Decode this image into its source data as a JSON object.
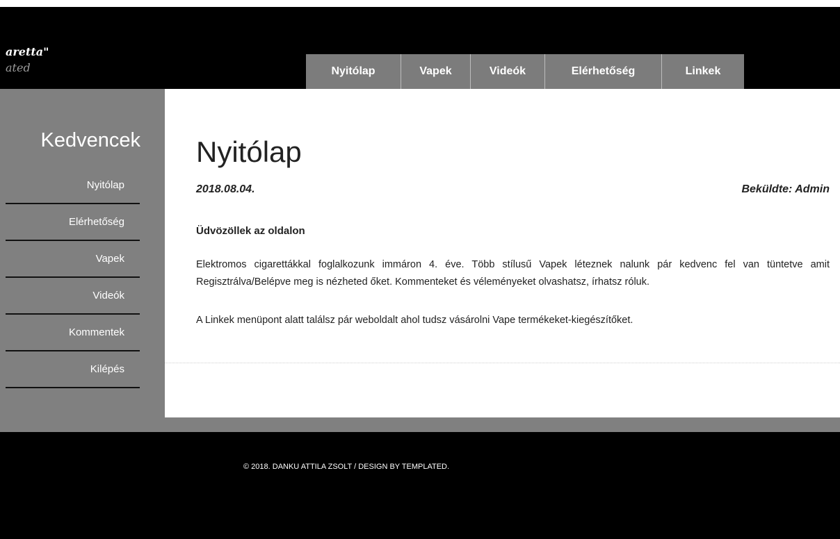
{
  "header": {
    "logo_line1": "aretta\"",
    "logo_line2": "ated"
  },
  "top_nav": [
    "Nyitólap",
    "Vapek",
    "Videók",
    "Elérhetőség",
    "Linkek"
  ],
  "sidebar": {
    "title": "Kedvencek",
    "items": [
      "Nyitólap",
      "Elérhetőség",
      "Vapek",
      "Videók",
      "Kommentek",
      "Kilépés"
    ]
  },
  "post": {
    "title": "Nyitólap",
    "date": "2018.08.04.",
    "author": "Beküldte: Admin",
    "welcome": "Üdvözöllek az oldalon",
    "paragraph1": "Elektromos cigarettákkal foglalkozunk immáron 4. éve. Több stílusű Vapek léteznek nalunk pár kedvenc fel van tüntetve amit Regisztrálva/Belépve meg is nézheted őket. Kommenteket és véleményeket olvashatsz, írhatsz róluk.",
    "paragraph2": "A Linkek menüpont alatt találsz pár weboldalt ahol tudsz vásárolni Vape termékeket-kiegészítőket."
  },
  "footer": {
    "text": "© 2018. DANKU ATTILA ZSOLT / DESIGN BY TEMPLATED."
  }
}
